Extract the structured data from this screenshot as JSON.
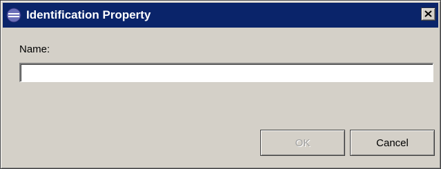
{
  "window": {
    "title": "Identification Property",
    "title_icon": "eclipse-icon",
    "close_glyph": "✕"
  },
  "form": {
    "name_label": "Name:",
    "name_value": "",
    "name_placeholder": ""
  },
  "buttons": {
    "ok_label": "OK",
    "ok_disabled": true,
    "cancel_label": "Cancel"
  },
  "colors": {
    "titlebar": "#0a246a",
    "dialog_bg": "#d4d0c8",
    "disabled_text": "#a0a0a0"
  }
}
